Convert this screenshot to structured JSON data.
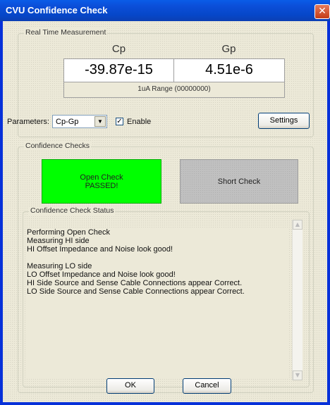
{
  "window": {
    "title": "CVU Confidence Check",
    "close_symbol": "✕"
  },
  "realtime": {
    "legend": "Real Time Measurement",
    "col1_header": "Cp",
    "col2_header": "Gp",
    "col1_value": "-39.87e-15",
    "col2_value": "4.51e-6",
    "range": "1uA Range (00000000)"
  },
  "parameters": {
    "label": "Parameters:",
    "selected": "Cp-Gp",
    "enable_label": "Enable",
    "enable_checked": true,
    "settings_label": "Settings"
  },
  "confidence": {
    "legend": "Confidence Checks",
    "open_check_line1": "Open Check",
    "open_check_line2": "PASSED!",
    "short_check_label": "Short Check",
    "open_color": "#00ff00",
    "short_color": "#c0c0c0"
  },
  "status": {
    "legend": "Confidence Check Status",
    "lines": [
      "Performing Open Check",
      "Measuring HI side",
      "HI Offset Impedance and Noise look good!",
      "",
      "Measuring LO side",
      "LO Offset Impedance and Noise look good!",
      "HI Side Source and Sense Cable Connections appear Correct.",
      "LO Side Source and Sense Cable Connections appear Correct."
    ]
  },
  "footer": {
    "ok_label": "OK",
    "cancel_label": "Cancel"
  }
}
